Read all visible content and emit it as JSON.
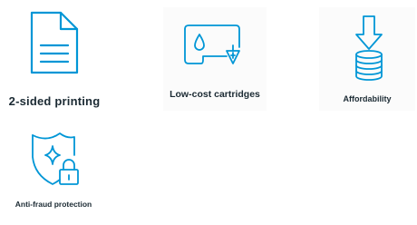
{
  "colors": {
    "icon": "#0096d6",
    "label": "#1b2a33",
    "card_bg": "#fbfbfb"
  },
  "features": [
    {
      "label": "2-sided printing",
      "icon": "document-icon"
    },
    {
      "label": "Low-cost cartridges",
      "icon": "ink-cartridge-icon"
    },
    {
      "label": "Affordability",
      "icon": "coins-down-arrow-icon"
    },
    {
      "label": "Anti-fraud protection",
      "icon": "shield-lock-icon"
    }
  ]
}
